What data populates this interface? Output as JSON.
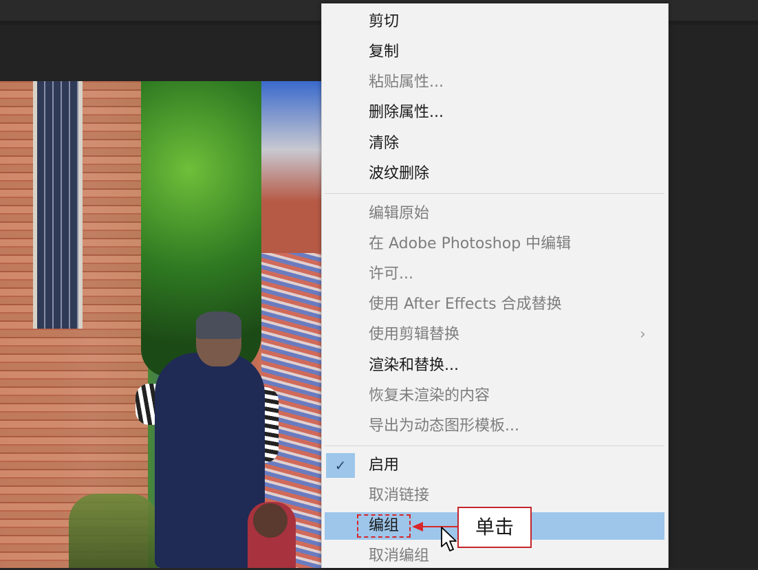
{
  "context_menu": {
    "items": [
      {
        "label": "剪切",
        "enabled": true
      },
      {
        "label": "复制",
        "enabled": true
      },
      {
        "label": "粘贴属性...",
        "enabled": false
      },
      {
        "label": "删除属性...",
        "enabled": true
      },
      {
        "label": "清除",
        "enabled": true
      },
      {
        "label": "波纹删除",
        "enabled": true
      },
      {
        "label": "编辑原始",
        "enabled": false
      },
      {
        "label": "在 Adobe Photoshop 中编辑",
        "enabled": false
      },
      {
        "label": "许可...",
        "enabled": false
      },
      {
        "label": "使用 After Effects 合成替换",
        "enabled": false
      },
      {
        "label": "使用剪辑替换",
        "enabled": false,
        "has_submenu": true
      },
      {
        "label": "渲染和替换...",
        "enabled": true
      },
      {
        "label": "恢复未渲染的内容",
        "enabled": false
      },
      {
        "label": "导出为动态图形模板...",
        "enabled": false
      },
      {
        "label": "启用",
        "enabled": true,
        "checked": true
      },
      {
        "label": "取消链接",
        "enabled": false
      },
      {
        "label": "编组",
        "enabled": true,
        "highlighted": true
      },
      {
        "label": "取消编组",
        "enabled": false
      }
    ],
    "submenu_arrow": "›",
    "checkmark": "✓"
  },
  "annotation": {
    "callout_text": "单击",
    "color": "#d8262a"
  },
  "colors": {
    "menu_bg": "#f2f2f2",
    "highlight": "#9dc6ea",
    "app_bg": "#262626"
  }
}
